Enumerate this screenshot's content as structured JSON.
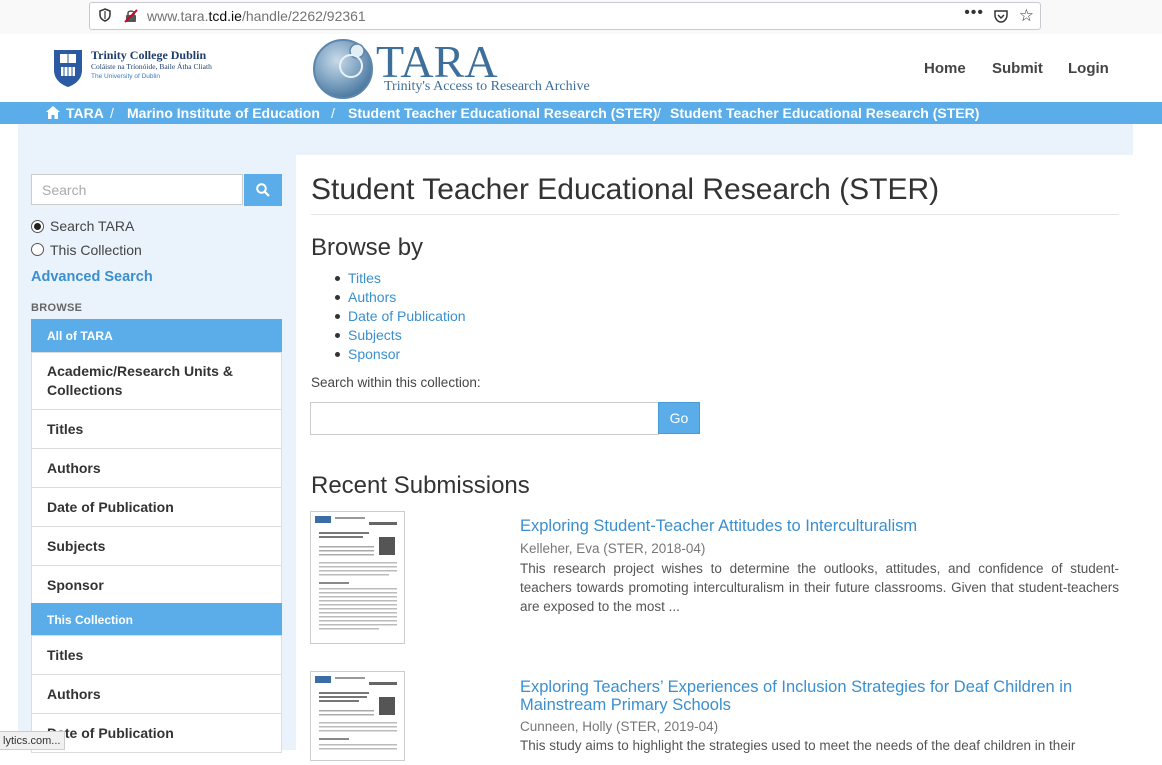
{
  "browser": {
    "url_prefix": "www.tara.",
    "url_domain": "tcd.ie",
    "url_path": "/handle/2262/92361",
    "menu_dots": "•••",
    "star": "☆"
  },
  "header": {
    "tcd_name": "Trinity College Dublin",
    "tcd_irish": "Coláiste na Tríonóide, Baile Átha Cliath",
    "tcd_university": "The University of Dublin",
    "tara_title": "TARA",
    "tara_subtitle": "Trinity's Access to Research Archive",
    "nav": {
      "home": "Home",
      "submit": "Submit",
      "login": "Login"
    }
  },
  "breadcrumb": {
    "items": [
      "TARA",
      "Marino Institute of Education",
      "Student Teacher Educational Research (STER)",
      "Student Teacher Educational Research (STER)"
    ],
    "separator": "/"
  },
  "sidebar": {
    "search_placeholder": "Search",
    "scope_options": [
      "Search TARA",
      "This Collection"
    ],
    "scope_selected": "Search TARA",
    "advanced_search": "Advanced Search",
    "browse_heading": "BROWSE",
    "all_of_tara_heading": "All of TARA",
    "all_of_tara_items": [
      "Academic/Research Units & Collections",
      "Titles",
      "Authors",
      "Date of Publication",
      "Subjects",
      "Sponsor"
    ],
    "this_collection_heading": "This Collection",
    "this_collection_items": [
      "Titles",
      "Authors",
      "Date of Publication"
    ]
  },
  "main": {
    "title": "Student Teacher Educational Research (STER)",
    "browse_by_heading": "Browse by",
    "browse_links": [
      "Titles",
      "Authors",
      "Date of Publication",
      "Subjects",
      "Sponsor"
    ],
    "search_within_label": "Search within this collection:",
    "go_button": "Go",
    "recent_heading": "Recent Submissions",
    "submissions": [
      {
        "title": "Exploring Student-Teacher Attitudes to Interculturalism",
        "meta": "Kelleher, Eva (STER, 2018-04)",
        "abstract": "This research project wishes to determine the outlooks, attitudes, and confidence of student-teachers towards promoting interculturalism in their future classrooms. Given that student-teachers are exposed to the most ..."
      },
      {
        "title": "Exploring Teachers’ Experiences of Inclusion Strategies for Deaf Children in Mainstream Primary Schools",
        "meta": "Cunneen, Holly (STER, 2019-04)",
        "abstract": "This study aims to highlight the strategies used to meet the needs of the deaf children in their"
      }
    ]
  },
  "status_bar": "lytics.com...",
  "colors": {
    "accent": "#5aade8",
    "link": "#3a8fce",
    "panel": "#eaf3fb"
  }
}
